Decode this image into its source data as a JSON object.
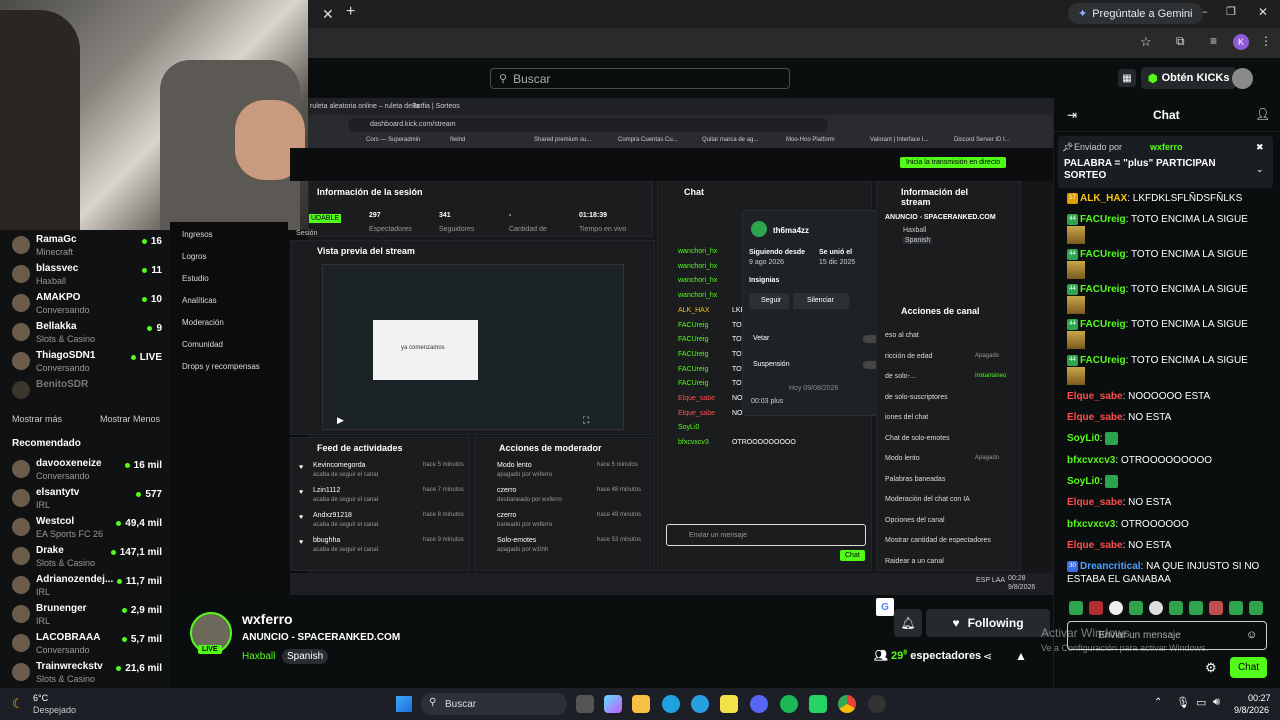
{
  "browser": {
    "gemini_label": "Pregúntale a Gemini",
    "profile_letter": "K"
  },
  "kick_header": {
    "search_placeholder": "Buscar",
    "kicks_label": "Obtén KICKs"
  },
  "sidebar": {
    "channels": [
      {
        "name": "RamaGc",
        "category": "Minecraft",
        "viewers": "16",
        "live": true
      },
      {
        "name": "blassvec",
        "category": "Haxball",
        "viewers": "11",
        "live": true
      },
      {
        "name": "AMAKPO",
        "category": "Conversando",
        "viewers": "10",
        "live": true
      },
      {
        "name": "Bellakka",
        "category": "Slots & Casino",
        "viewers": "9",
        "live": true
      },
      {
        "name": "ThiagoSDN1",
        "category": "Conversando",
        "viewers": "LIVE",
        "live": true
      },
      {
        "name": "BenitoSDR",
        "category": "",
        "viewers": "",
        "live": false
      }
    ],
    "show_more": "Mostrar más",
    "show_less": "Mostrar Menos",
    "recommended_title": "Recomendado",
    "recommended": [
      {
        "name": "davooxeneize",
        "category": "Conversando",
        "viewers": "16 mil"
      },
      {
        "name": "elsantytv",
        "category": "IRL",
        "viewers": "577"
      },
      {
        "name": "Westcol",
        "category": "EA Sports FC 26",
        "viewers": "49,4 mil"
      },
      {
        "name": "Drake",
        "category": "Slots & Casino",
        "viewers": "147,1 mil"
      },
      {
        "name": "Adrianozendej...",
        "category": "IRL",
        "viewers": "11,7 mil"
      },
      {
        "name": "Brunenger",
        "category": "IRL",
        "viewers": "2,9 mil"
      },
      {
        "name": "LACOBRAAA",
        "category": "Conversando",
        "viewers": "5,7 mil"
      },
      {
        "name": "Trainwreckstv",
        "category": "Slots & Casino",
        "viewers": "21,6 mil"
      }
    ]
  },
  "dash_menu": [
    "Ingresos",
    "Logros",
    "Estudio",
    "Analíticas",
    "Moderación",
    "Comunidad",
    "Drops y recompensas"
  ],
  "embed": {
    "tab1": "ruleta aleatoria online – ruleta de la",
    "tab2": "Botfia | Sorteos",
    "url": "dashboard.kick.com/stream",
    "bookmarks": [
      "Cors — Superadmin",
      "fiwind",
      "Shared premium su...",
      "Compra Cuentas Cu...",
      "Quitar marca de ag...",
      "Moo-Hoo Platform",
      "Valorant | Interface I...",
      "Discord Server ID I..."
    ],
    "start_stream": "Inicia la transmisión en directo",
    "session_title": "Información de la sesión",
    "session_stats": [
      {
        "value": "297",
        "label": "Espectadores"
      },
      {
        "value": "341",
        "label": "Seguidores"
      },
      {
        "value": "-",
        "label": "Cantidad de"
      },
      {
        "value": "01:18:39",
        "label": "Tiempo en vivo"
      }
    ],
    "session_tag": "UDABLE",
    "session_label": "Sesión",
    "preview_title": "Vista previa del stream",
    "preview_text": "ya comenzamos",
    "feed_title": "Feed de actividades",
    "feed": [
      {
        "user": "Kevincomegorda",
        "action": "acaba de seguir el canal",
        "time": "hace 5 minutos"
      },
      {
        "user": "Lzin1112",
        "action": "acaba de seguir el canal",
        "time": "hace 7 minutos"
      },
      {
        "user": "Andxz91218",
        "action": "acaba de seguir el canal",
        "time": "hace 8 minutos"
      },
      {
        "user": "bbughha",
        "action": "acaba de seguir el canal",
        "time": "hace 9 minutos"
      }
    ],
    "mod_title": "Acciones de moderador",
    "mod": [
      {
        "action": "Modo lento",
        "by": "apagado por wxferro",
        "time": "hace 5 minutos"
      },
      {
        "action": "czerro",
        "by": "desbaneado por wxferro",
        "time": "hace 48 minutos"
      },
      {
        "action": "czerro",
        "by": "baneado por wxferro",
        "time": "hace 48 minutos"
      },
      {
        "action": "Solo-emotes",
        "by": "apagado por w1thh",
        "time": "hace 53 minutos"
      }
    ],
    "chat_title": "Chat",
    "chat_lines": [
      {
        "user": "wanchori_hx",
        "text": ""
      },
      {
        "user": "wanchori_hx",
        "text": ""
      },
      {
        "user": "wanchori_hx",
        "text": ""
      },
      {
        "user": "wanchori_hx",
        "text": ""
      },
      {
        "user": "ALK_HAX",
        "text": "LKFDKL"
      },
      {
        "user": "FACUreig",
        "text": "TOTO E"
      },
      {
        "user": "FACUreig",
        "text": "TOTO E"
      },
      {
        "user": "FACUreig",
        "text": "TOTO E"
      },
      {
        "user": "FACUreig",
        "text": "TOTO E"
      },
      {
        "user": "FACUreig",
        "text": "TOTO ENCIMA LA SIGUE"
      },
      {
        "user": "Elque_sabe",
        "text": "NOOOOOO ESTA"
      },
      {
        "user": "Elque_sabe",
        "text": "NO ESTA"
      },
      {
        "user": "SoyLi0",
        "text": ""
      },
      {
        "user": "bfxcvxcv3",
        "text": "OTROOOOOOOOO"
      }
    ],
    "chat_placeholder": "Enviar un mensaje",
    "chat_send": "Chat",
    "user_card": {
      "name": "th6ma4zz",
      "following_since_label": "Siguiendo desde",
      "following_since": "9 ago 2026",
      "joined_label": "Se unió el",
      "joined": "15 dic 2025",
      "badges_label": "Insignias",
      "follow": "Seguir",
      "mute": "Silenciar",
      "ban": "Vetar",
      "timeout": "Suspensión",
      "date_divider": "Hoy 09/08/2026",
      "log_line": "00:03 plus"
    },
    "stream_info_title": "Información del stream",
    "stream_info_name": "ANUNCIO - SPACERANKED.COM",
    "stream_info_cat": "Haxball",
    "stream_info_lang": "Spanish",
    "channel_actions_title": "Acciones de canal",
    "channel_actions": [
      {
        "label": "eso al chat",
        "value": ""
      },
      {
        "label": "ricción de edad",
        "value": "Apagado"
      },
      {
        "label": "de solo-...",
        "value": "Instantáneo"
      },
      {
        "label": "de solo-suscriptores",
        "value": ""
      },
      {
        "label": "iones del chat",
        "value": ""
      },
      {
        "label": "Chat de solo-emotes",
        "value": ""
      },
      {
        "label": "Modo lento",
        "value": "Apagado"
      },
      {
        "label": "Palabras baneadas",
        "value": ""
      },
      {
        "label": "Moderación del chat con IA",
        "value": ""
      },
      {
        "label": "Opciones del canal",
        "value": ""
      },
      {
        "label": "Mostrar cantidad de espectadores",
        "value": ""
      },
      {
        "label": "Raidear a un canal",
        "value": ""
      }
    ],
    "taskbar_lang": "ESP LAA",
    "taskbar_time": "00:28",
    "taskbar_date": "9/8/2026"
  },
  "stream": {
    "streamer": "wxferro",
    "title": "ANUNCIO - SPACERANKED.COM",
    "category": "Haxball",
    "language": "Spanish",
    "live": "LIVE",
    "following": "Following",
    "viewers_prefix": "29",
    "viewers_sup": "8",
    "viewers_label": "espectadores"
  },
  "chat": {
    "title": "Chat",
    "pinned_by": "Enviado por",
    "pinned_user": "wxferro",
    "pinned_text": "PALABRA = \"plus\" PARTICIPAN SORTEO",
    "messages": [
      {
        "badge": "17",
        "user": "ALK_HAX",
        "color": "#f5c518",
        "text": "LKFDKLSFLÑDSFÑLKS",
        "emote": false
      },
      {
        "badge": "44",
        "user": "FACUreig",
        "color": "#53fc18",
        "text": "TOTO ENCIMA LA SIGUE",
        "emote": true
      },
      {
        "badge": "44",
        "user": "FACUreig",
        "color": "#53fc18",
        "text": "TOTO ENCIMA LA SIGUE",
        "emote": true
      },
      {
        "badge": "44",
        "user": "FACUreig",
        "color": "#53fc18",
        "text": "TOTO ENCIMA LA SIGUE",
        "emote": true
      },
      {
        "badge": "44",
        "user": "FACUreig",
        "color": "#53fc18",
        "text": "TOTO ENCIMA LA SIGUE",
        "emote": true
      },
      {
        "badge": "44",
        "user": "FACUreig",
        "color": "#53fc18",
        "text": "TOTO ENCIMA LA SIGUE",
        "emote": true
      },
      {
        "badge": "",
        "user": "Elque_sabe",
        "color": "#ff4d4d",
        "text": "NOOOOOO ESTA",
        "emote": false
      },
      {
        "badge": "",
        "user": "Elque_sabe",
        "color": "#ff4d4d",
        "text": "NO ESTA",
        "emote": false
      },
      {
        "badge": "",
        "user": "SoyLi0",
        "color": "#53fc18",
        "text": "",
        "emote": false
      },
      {
        "badge": "",
        "user": "bfxcvxcv3",
        "color": "#53fc18",
        "text": "OTROOOOOOOOO",
        "emote": false
      },
      {
        "badge": "",
        "user": "SoyLi0",
        "color": "#53fc18",
        "text": "",
        "emote": false
      },
      {
        "badge": "",
        "user": "Elque_sabe",
        "color": "#ff4d4d",
        "text": "NO ESTA",
        "emote": false
      },
      {
        "badge": "",
        "user": "bfxcvxcv3",
        "color": "#53fc18",
        "text": "OTROOOOOO",
        "emote": false
      },
      {
        "badge": "",
        "user": "Elque_sabe",
        "color": "#ff4d4d",
        "text": "NO ESTA",
        "emote": false
      },
      {
        "badge": "30",
        "user": "Dreancritical",
        "color": "#4da3ff",
        "text": "NA QUE INJUSTO SI NO ESTABA EL GANABAA",
        "emote": false
      }
    ],
    "input_placeholder": "Enviar un mensaje",
    "send": "Chat",
    "activate_title": "Activar Windows",
    "activate_sub": "Ve a Configuración para activar Windows."
  },
  "taskbar": {
    "weather_temp": "6°C",
    "weather_desc": "Despejado",
    "search": "Buscar",
    "time": "00:27",
    "date": "9/8/2026"
  },
  "colors": {
    "kick_green": "#53fc18",
    "bg": "#0b0e0f",
    "danger": "#ff4d4d"
  }
}
